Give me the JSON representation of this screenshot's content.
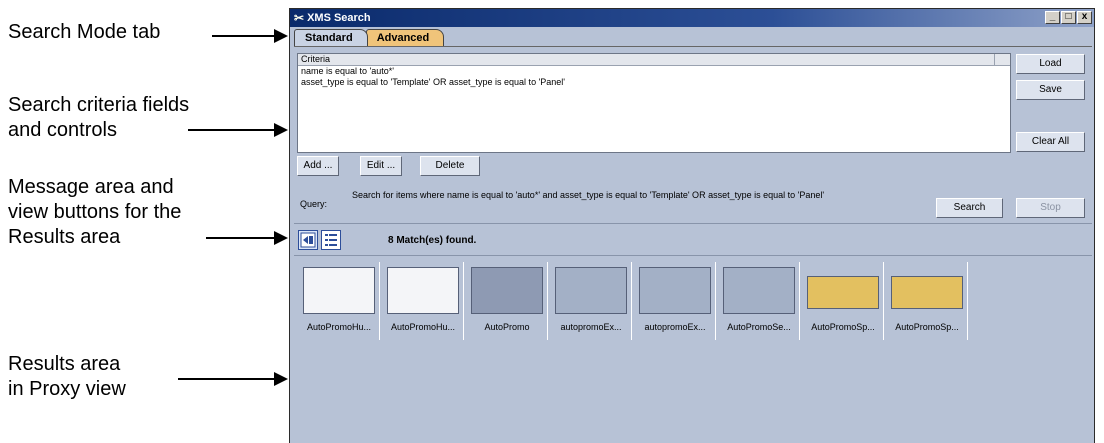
{
  "callouts": [
    {
      "line1": "Search Mode tab",
      "line2": ""
    },
    {
      "line1": "Search criteria fields",
      "line2": "and controls"
    },
    {
      "line1": "Message area and",
      "line2": "view buttons for the",
      "line3": "Results area"
    },
    {
      "line1": "Results area",
      "line2": "in Proxy view"
    }
  ],
  "window": {
    "title": "XMS Search",
    "controls": [
      "_",
      "□",
      "x"
    ]
  },
  "tabs": [
    {
      "label": "Standard",
      "active": true
    },
    {
      "label": "Advanced",
      "active": false
    }
  ],
  "criteria": {
    "header": "Criteria",
    "rows": [
      "name is equal to 'auto*'",
      "asset_type is equal to 'Template' OR asset_type is equal to 'Panel'"
    ]
  },
  "buttons": {
    "load": "Load",
    "save": "Save",
    "clear_all": "Clear All",
    "add": "Add ...",
    "edit": "Edit ...",
    "delete": "Delete",
    "search": "Search",
    "stop": "Stop"
  },
  "query": {
    "label": "Query:",
    "text": "Search for items where name is equal to 'auto*' and asset_type is equal to 'Template' OR asset_type is equal to 'Panel'"
  },
  "message": {
    "matches": "8 Match(es) found."
  },
  "results": [
    {
      "label": "AutoPromoHu...",
      "thumb": "white"
    },
    {
      "label": "AutoPromoHu...",
      "thumb": "white"
    },
    {
      "label": "AutoPromo",
      "thumb": "dark"
    },
    {
      "label": "autopromoEx...",
      "thumb": "gray"
    },
    {
      "label": "autopromoEx...",
      "thumb": "gray"
    },
    {
      "label": "AutoPromoSe...",
      "thumb": "gray"
    },
    {
      "label": "AutoPromoSp...",
      "thumb": "yellow"
    },
    {
      "label": "AutoPromoSp...",
      "thumb": "yellow"
    }
  ]
}
